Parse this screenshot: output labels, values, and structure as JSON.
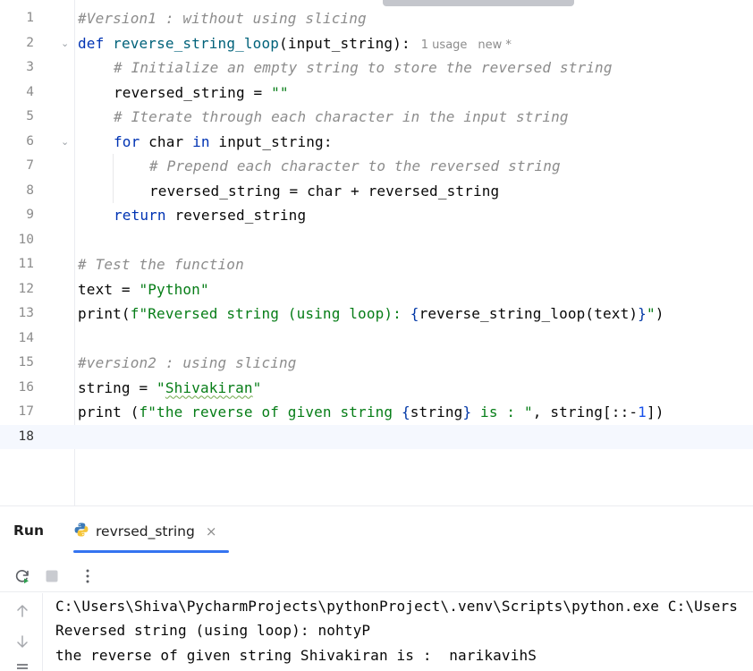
{
  "editor": {
    "current_line": 18,
    "line_numbers": [
      "1",
      "2",
      "3",
      "4",
      "5",
      "6",
      "7",
      "8",
      "9",
      "10",
      "11",
      "12",
      "13",
      "14",
      "15",
      "16",
      "17",
      "18"
    ],
    "code": {
      "l1_comment": "#Version1 : without using slicing",
      "l2_def": "def",
      "l2_space": " ",
      "l2_name": "reverse_string_loop",
      "l2_params": "(input_string):",
      "l2_usage_hint": "1 usage",
      "l2_new_hint": "new *",
      "l3_comment": "# Initialize an empty string to store the reversed string",
      "l4_var": "reversed_string = ",
      "l4_str": "\"\"",
      "l5_comment": "# Iterate through each character in the input string",
      "l6_for": "for",
      "l6_mid": " char ",
      "l6_in": "in",
      "l6_rest": " input_string:",
      "l7_comment": "# Prepend each character to the reversed string",
      "l8_code": "reversed_string = char + reversed_string",
      "l9_return": "return",
      "l9_rest": " reversed_string",
      "l11_comment": "# Test the function",
      "l12_var": "text = ",
      "l12_str": "\"Python\"",
      "l13_print": "print(",
      "l13_str": "f\"Reversed string (using loop): ",
      "l13_brace_open": "{",
      "l13_expr": "reverse_string_loop(text)",
      "l13_brace_close": "}",
      "l13_str_end": "\"",
      "l13_close": ")",
      "l15_comment": "#version2 : using slicing",
      "l16_var": "string = ",
      "l16_q1": "\"",
      "l16_word": "Shivakiran",
      "l16_q2": "\"",
      "l17_print": "print (",
      "l17_str": "f\"the reverse of given string ",
      "l17_brace_open": "{",
      "l17_expr": "string",
      "l17_brace_close": "}",
      "l17_str_end": " is : \"",
      "l17_mid": ", string[::-",
      "l17_num": "1",
      "l17_close": "])"
    }
  },
  "run_panel": {
    "title": "Run",
    "tab_label": "revrsed_string",
    "tab_close": "×",
    "console": [
      "C:\\Users\\Shiva\\PycharmProjects\\pythonProject\\.venv\\Scripts\\python.exe C:\\Users",
      "Reversed string (using loop): nohtyP",
      "the reverse of given string Shivakiran is :  narikavihS"
    ]
  },
  "colors": {
    "keyword": "#0033b3",
    "function": "#00627a",
    "string": "#067d17",
    "comment": "#8c8c8c",
    "number": "#1750eb",
    "accent": "#3574f0",
    "current_line_bg": "#f5f8fe"
  }
}
